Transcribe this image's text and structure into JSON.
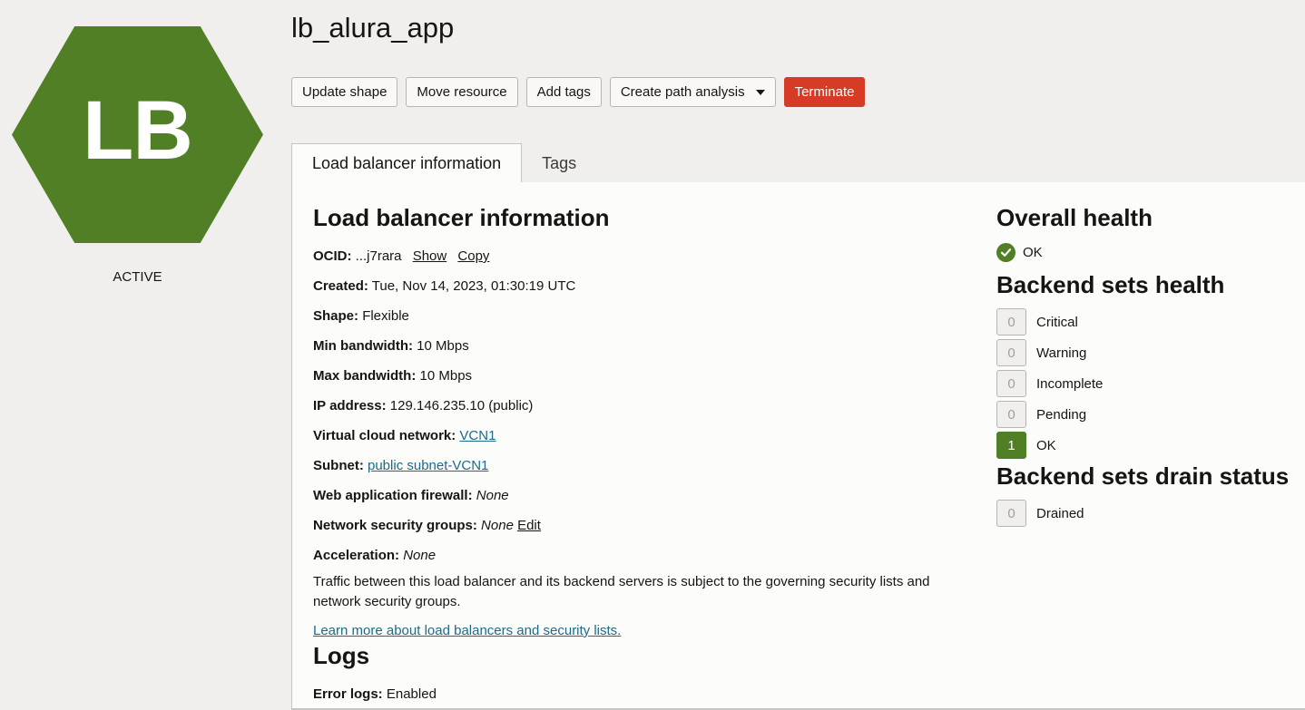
{
  "resource": {
    "icon_text": "LB",
    "icon_color": "#507f25",
    "state": "ACTIVE",
    "title": "lb_alura_app"
  },
  "actions": {
    "update_shape": "Update shape",
    "move_resource": "Move resource",
    "add_tags": "Add tags",
    "create_path_analysis": "Create path analysis",
    "terminate": "Terminate"
  },
  "tabs": [
    {
      "label": "Load balancer information",
      "active": true
    },
    {
      "label": "Tags",
      "active": false
    }
  ],
  "info": {
    "heading": "Load balancer information",
    "ocid_label": "OCID:",
    "ocid_value": "...j7rara",
    "ocid_show": "Show",
    "ocid_copy": "Copy",
    "created_label": "Created:",
    "created_value": "Tue, Nov 14, 2023, 01:30:19 UTC",
    "shape_label": "Shape:",
    "shape_value": "Flexible",
    "min_bw_label": "Min bandwidth:",
    "min_bw_value": "10 Mbps",
    "max_bw_label": "Max bandwidth:",
    "max_bw_value": "10 Mbps",
    "ip_label": "IP address:",
    "ip_value": "129.146.235.10 (public)",
    "vcn_label": "Virtual cloud network:",
    "vcn_value": "VCN1",
    "subnet_label": "Subnet:",
    "subnet_value": "public subnet-VCN1",
    "waf_label": "Web application firewall:",
    "waf_value": "None",
    "nsg_label": "Network security groups:",
    "nsg_value": "None",
    "nsg_edit": "Edit",
    "accel_label": "Acceleration:",
    "accel_value": "None",
    "traffic_note": "Traffic between this load balancer and its backend servers is subject to the governing security lists and network security groups.",
    "learn_more": "Learn more about load balancers and security lists."
  },
  "logs": {
    "heading": "Logs",
    "error_logs_label": "Error logs:",
    "error_logs_value": "Enabled"
  },
  "health": {
    "overall_heading": "Overall health",
    "overall_status": "OK",
    "backend_heading": "Backend sets health",
    "backend": [
      {
        "label": "Critical",
        "count": "0"
      },
      {
        "label": "Warning",
        "count": "0"
      },
      {
        "label": "Incomplete",
        "count": "0"
      },
      {
        "label": "Pending",
        "count": "0"
      },
      {
        "label": "OK",
        "count": "1"
      }
    ],
    "drain_heading": "Backend sets drain status",
    "drain": [
      {
        "label": "Drained",
        "count": "0"
      }
    ]
  }
}
